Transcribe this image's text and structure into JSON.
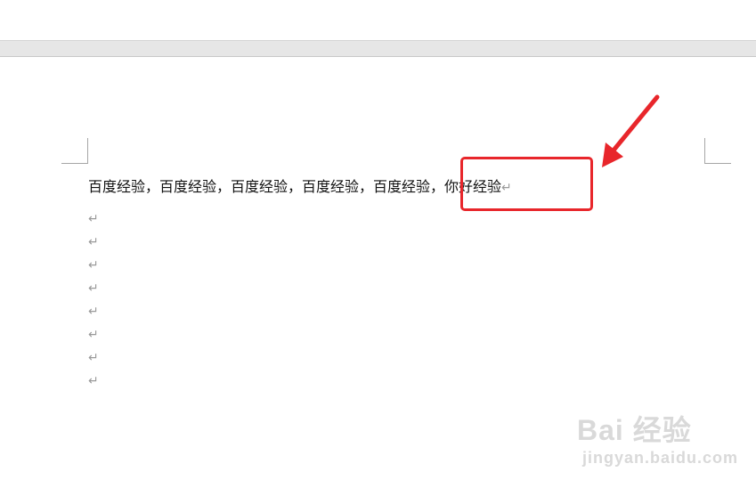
{
  "document": {
    "first_line": "百度经验，百度经验，百度经验，百度经验，百度经验，你好经验",
    "paragraph_mark": "↵",
    "empty_paragraph_mark": "↵"
  },
  "annotation": {
    "box_color": "#e8262b",
    "arrow_color": "#e8262b"
  },
  "watermark": {
    "logo": "Bai 经验",
    "url": "jingyan.baidu.com"
  }
}
